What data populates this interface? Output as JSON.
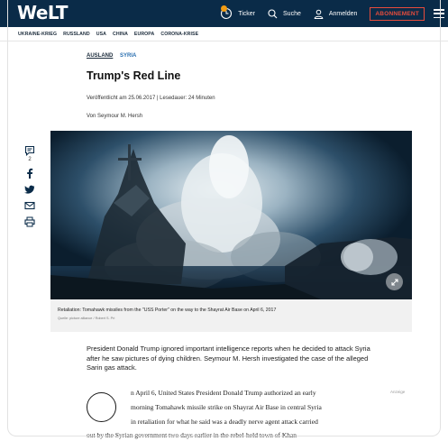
{
  "header": {
    "logo": "WeLT",
    "ticker": "Ticker",
    "search": "Suche",
    "login": "Anmelden",
    "subscribe": "ABONNEMENT",
    "colors": {
      "bar": "#0a2b48",
      "accent": "#e74c3c",
      "ticker_dot": "#f39c12"
    }
  },
  "nav": {
    "items": [
      "UKRAINE-KRIEG",
      "RUSSLAND",
      "USA",
      "CHINA",
      "EUROPA",
      "CORONA-KRISE"
    ]
  },
  "article": {
    "kicker_primary": "AUSLAND",
    "kicker_secondary": "SYRIA",
    "title": "Trump's Red Line",
    "meta": "Veröffentlicht am 25.06.2017 | Lesedauer: 24 Minuten",
    "author": "Von Seymour M. Hersh",
    "image_caption": "Retaliation: Tomahawk missiles from the \"USS Porter\" on the way to the Shayrat Air Base on April 6, 2017",
    "image_credit": "Quelle: picture alliance / Robert S. Pri",
    "intro": "President Donald Trump ignored important intelligence reports when he decided to attack Syria after he saw pictures of dying children. Seymour M. Hersh investigated the case of the alleged Sarin gas attack.",
    "body_lines": [
      "n April 6, United States President Donald Trump authorized an early",
      "morning Tomahawk missile strike on Shayrat Air Base in central Syria",
      "in retaliation for what he said was a deadly nerve agent attack carried",
      "out by the Syrian government two days earlier in the rebel-held town of Khan"
    ],
    "ad_label": "Anzeige"
  },
  "social": {
    "comments_count": "2",
    "icons": [
      "comment-icon",
      "facebook-icon",
      "twitter-icon",
      "mail-icon",
      "print-icon"
    ]
  }
}
